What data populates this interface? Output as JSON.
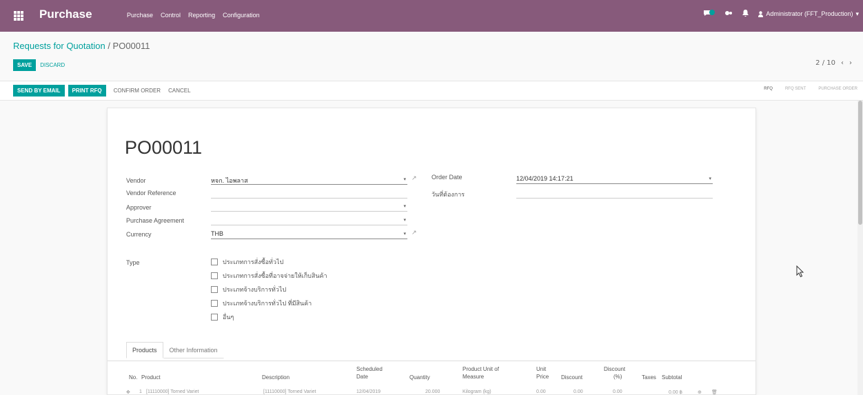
{
  "navbar": {
    "app_name": "Purchase",
    "menu": [
      "Purchase",
      "Control",
      "Reporting",
      "Configuration"
    ],
    "user": "Administrator (FFT_Production)",
    "bg_color": "#875a7b"
  },
  "breadcrumb": {
    "parent": "Requests for Quotation",
    "separator": " / ",
    "current": "PO00011"
  },
  "buttons": {
    "save": "SAVE",
    "discard": "DISCARD",
    "send_by_email": "SEND BY EMAIL",
    "print_rfq": "PRINT RFQ",
    "confirm_order": "CONFIRM ORDER",
    "cancel": "CANCEL"
  },
  "pager": {
    "value": "2 / 10",
    "prev": "‹",
    "next": "›"
  },
  "stages": {
    "rfq": "RFQ",
    "rfq_sent": "RFQ SENT",
    "purchase_order": "PURCHASE ORDER"
  },
  "form": {
    "title": "PO00011",
    "vendor_label": "Vendor",
    "vendor_value": "หจก. ไอพลาส",
    "vendor_ref_label": "Vendor Reference",
    "vendor_ref_value": "",
    "approver_label": "Approver",
    "approver_value": "",
    "agreement_label": "Purchase Agreement",
    "agreement_value": "",
    "currency_label": "Currency",
    "currency_value": "THB",
    "order_date_label": "Order Date",
    "order_date_value": "12/04/2019 14:17:21",
    "deadline_label": "วันที่ต้องการ",
    "deadline_value": "",
    "type_label": "Type",
    "type_options": [
      "ประเภทการสั่งซื้อทั่วไป",
      "ประเภทการสั่งซื้อที่อาจจ่ายให้เก็บสินค้า",
      "ประเภทจ้างบริการทั่วไป",
      "ประเภทจ้างบริการทั่วไป ที่มีสินค้า",
      "อื่นๆ"
    ]
  },
  "tabs": {
    "products": "Products",
    "other": "Other Information"
  },
  "table": {
    "headers": {
      "no": "No.",
      "product": "Product",
      "description": "Description",
      "scheduled_1": "Scheduled",
      "scheduled_2": "Date",
      "quantity": "Quantity",
      "uom_1": "Product Unit of",
      "uom_2": "Measure",
      "unit_1": "Unit",
      "unit_2": "Price",
      "discount": "Discount",
      "discount_pct_1": "Discount",
      "discount_pct_2": "(%)",
      "taxes": "Taxes",
      "subtotal": "Subtotal"
    },
    "row": {
      "no": "1",
      "product": "[11110000] Torned Variet",
      "description": "[11110000] Torned Variet",
      "date": "12/04/2019",
      "qty": "20.000",
      "uom": "Kilogram (kg)",
      "price": "0.00",
      "discount": "0.00",
      "discount_pct": "0.00",
      "subtotal": "0.00 ฿"
    }
  }
}
